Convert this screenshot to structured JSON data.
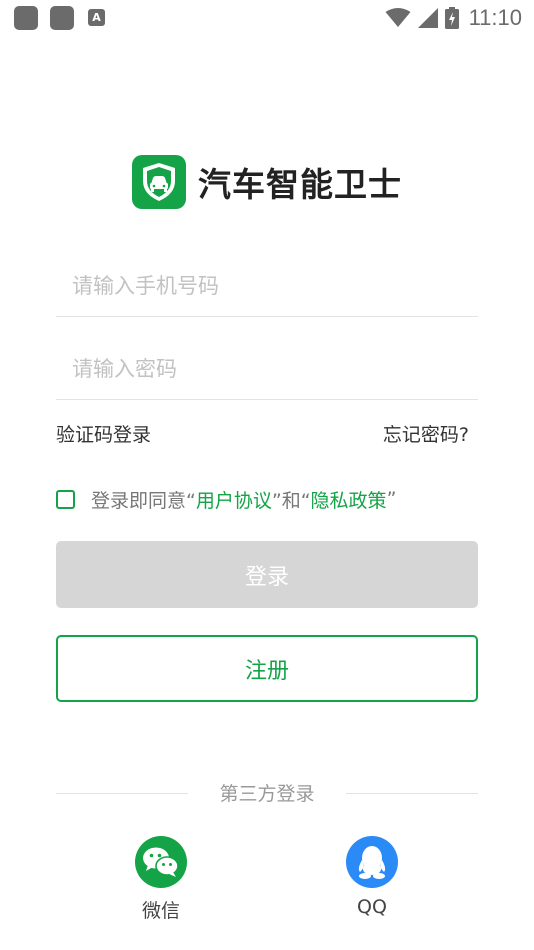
{
  "status_bar": {
    "time": "11:10",
    "notification_badge": "A"
  },
  "app": {
    "title": "汽车智能卫士"
  },
  "form": {
    "phone_placeholder": "请输入手机号码",
    "password_placeholder": "请输入密码",
    "sms_login_label": "验证码登录",
    "forgot_password_label": "忘记密码?",
    "agreement": {
      "prefix": "登录即同意“",
      "user_agreement": "用户协议",
      "mid": "”和“",
      "privacy_policy": "隐私政策",
      "suffix": "”"
    },
    "login_label": "登录",
    "register_label": "注册"
  },
  "third_party": {
    "label": "第三方登录",
    "wechat_label": "微信",
    "qq_label": "QQ"
  },
  "colors": {
    "brand_green": "#14a447",
    "disabled_button": "#d6d6d6",
    "qq_blue": "#2a8af6"
  },
  "icons": {
    "logo": "shield-car-icon",
    "wechat": "wechat-icon",
    "qq": "qq-icon",
    "wifi": "wifi-icon",
    "signal": "signal-icon",
    "battery": "battery-icon"
  }
}
